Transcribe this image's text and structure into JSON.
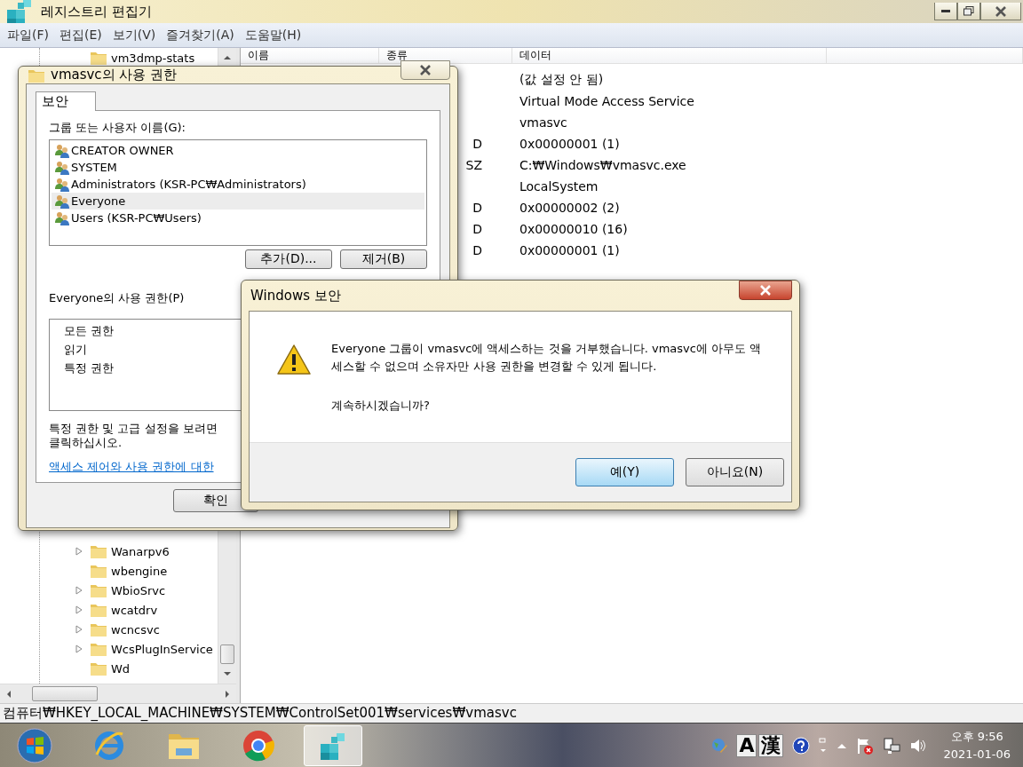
{
  "registry_window": {
    "title": "레지스트리 편집기",
    "menu": [
      "파일(F)",
      "편집(E)",
      "보기(V)",
      "즐겨찾기(A)",
      "도움말(H)"
    ],
    "tree": {
      "top_items": [
        {
          "label": "vm3dmp-stats",
          "expandable": false
        }
      ],
      "items": [
        {
          "label": "Wanarpv6",
          "expandable": true
        },
        {
          "label": "wbengine",
          "expandable": false
        },
        {
          "label": "WbioSrvc",
          "expandable": true
        },
        {
          "label": "wcatdrv",
          "expandable": true
        },
        {
          "label": "wcncsvc",
          "expandable": true
        },
        {
          "label": "WcsPlugInService",
          "expandable": true
        },
        {
          "label": "Wd",
          "expandable": false
        }
      ]
    },
    "list": {
      "columns": [
        "이름",
        "종류",
        "데이터"
      ],
      "rows": [
        {
          "data": "(값 설정 안 됨)"
        },
        {
          "data": "Virtual Mode Access Service"
        },
        {
          "data": "vmasvc"
        },
        {
          "type": "D",
          "data": "0x00000001 (1)"
        },
        {
          "type": "SZ",
          "data": "C:₩Windows₩vmasvc.exe"
        },
        {
          "data": "LocalSystem"
        },
        {
          "type": "D",
          "data": "0x00000002 (2)"
        },
        {
          "type": "D",
          "data": "0x00000010 (16)"
        },
        {
          "type": "D",
          "data": "0x00000001 (1)"
        }
      ]
    },
    "status_bar": "컴퓨터₩HKEY_LOCAL_MACHINE₩SYSTEM₩ControlSet001₩services₩vmasvc"
  },
  "permissions_dialog": {
    "title": "vmasvc의 사용 권한",
    "tabs": [
      {
        "label": "보안",
        "selected": true
      }
    ],
    "users_label": "그룹 또는 사용자 이름(G):",
    "users": [
      {
        "name": "CREATOR OWNER",
        "selected": false
      },
      {
        "name": "SYSTEM",
        "selected": false
      },
      {
        "name": "Administrators (KSR-PC₩Administrators)",
        "selected": false
      },
      {
        "name": "Everyone",
        "selected": true
      },
      {
        "name": "Users (KSR-PC₩Users)",
        "selected": false
      }
    ],
    "buttons": [
      "추가(D)...",
      "제거(B)"
    ],
    "permissions_label": "Everyone의 사용 권한(P)",
    "permissions": [
      "모든 권한",
      "읽기",
      "특정 권한"
    ],
    "hint_lines": [
      "특정 권한 및 고급 설정을 보려면",
      "클릭하십시오."
    ],
    "link": "액세스 제어와 사용 권한에 대한",
    "ok_button": "확인"
  },
  "security_dialog": {
    "title": "Windows 보안",
    "message": "Everyone 그룹이 vmasvc에 액세스하는 것을 거부했습니다. vmasvc에 아무도 액세스할 수 없으며 소유자만 사용 권한을 변경할 수 있게 됩니다.",
    "question": "계속하시겠습니까?",
    "buttons": [
      {
        "label": "예(Y)",
        "default": true
      },
      {
        "label": "아니요(N)",
        "default": false
      }
    ]
  },
  "taskbar": {
    "apps": [
      {
        "kind": "start",
        "selected": false
      },
      {
        "kind": "browser",
        "selected": false
      },
      {
        "kind": "folder",
        "selected": false
      },
      {
        "kind": "chrome",
        "selected": false
      },
      {
        "kind": "registry",
        "selected": true
      }
    ],
    "ime": [
      "A",
      "漢"
    ],
    "time": "오후 9:56",
    "date": "2021-01-06"
  }
}
